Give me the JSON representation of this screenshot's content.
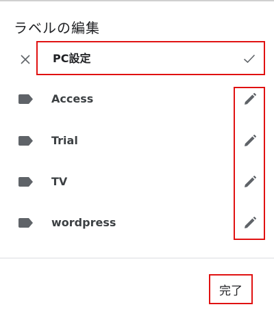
{
  "dialog": {
    "title": "ラベルの編集",
    "edit_row": {
      "close_icon": "close-icon",
      "value": "PC設定",
      "confirm_icon": "check-icon"
    },
    "labels": [
      {
        "name": "Access",
        "icon": "label-tag-icon",
        "action_icon": "pencil-icon"
      },
      {
        "name": "Trial",
        "icon": "label-tag-icon",
        "action_icon": "pencil-icon"
      },
      {
        "name": "TV",
        "icon": "label-tag-icon",
        "action_icon": "pencil-icon"
      },
      {
        "name": "wordpress",
        "icon": "label-tag-icon",
        "action_icon": "pencil-icon"
      }
    ],
    "done_label": "完了"
  },
  "colors": {
    "highlight": "#e01010",
    "icon": "#5f6368",
    "text": "#202124"
  }
}
